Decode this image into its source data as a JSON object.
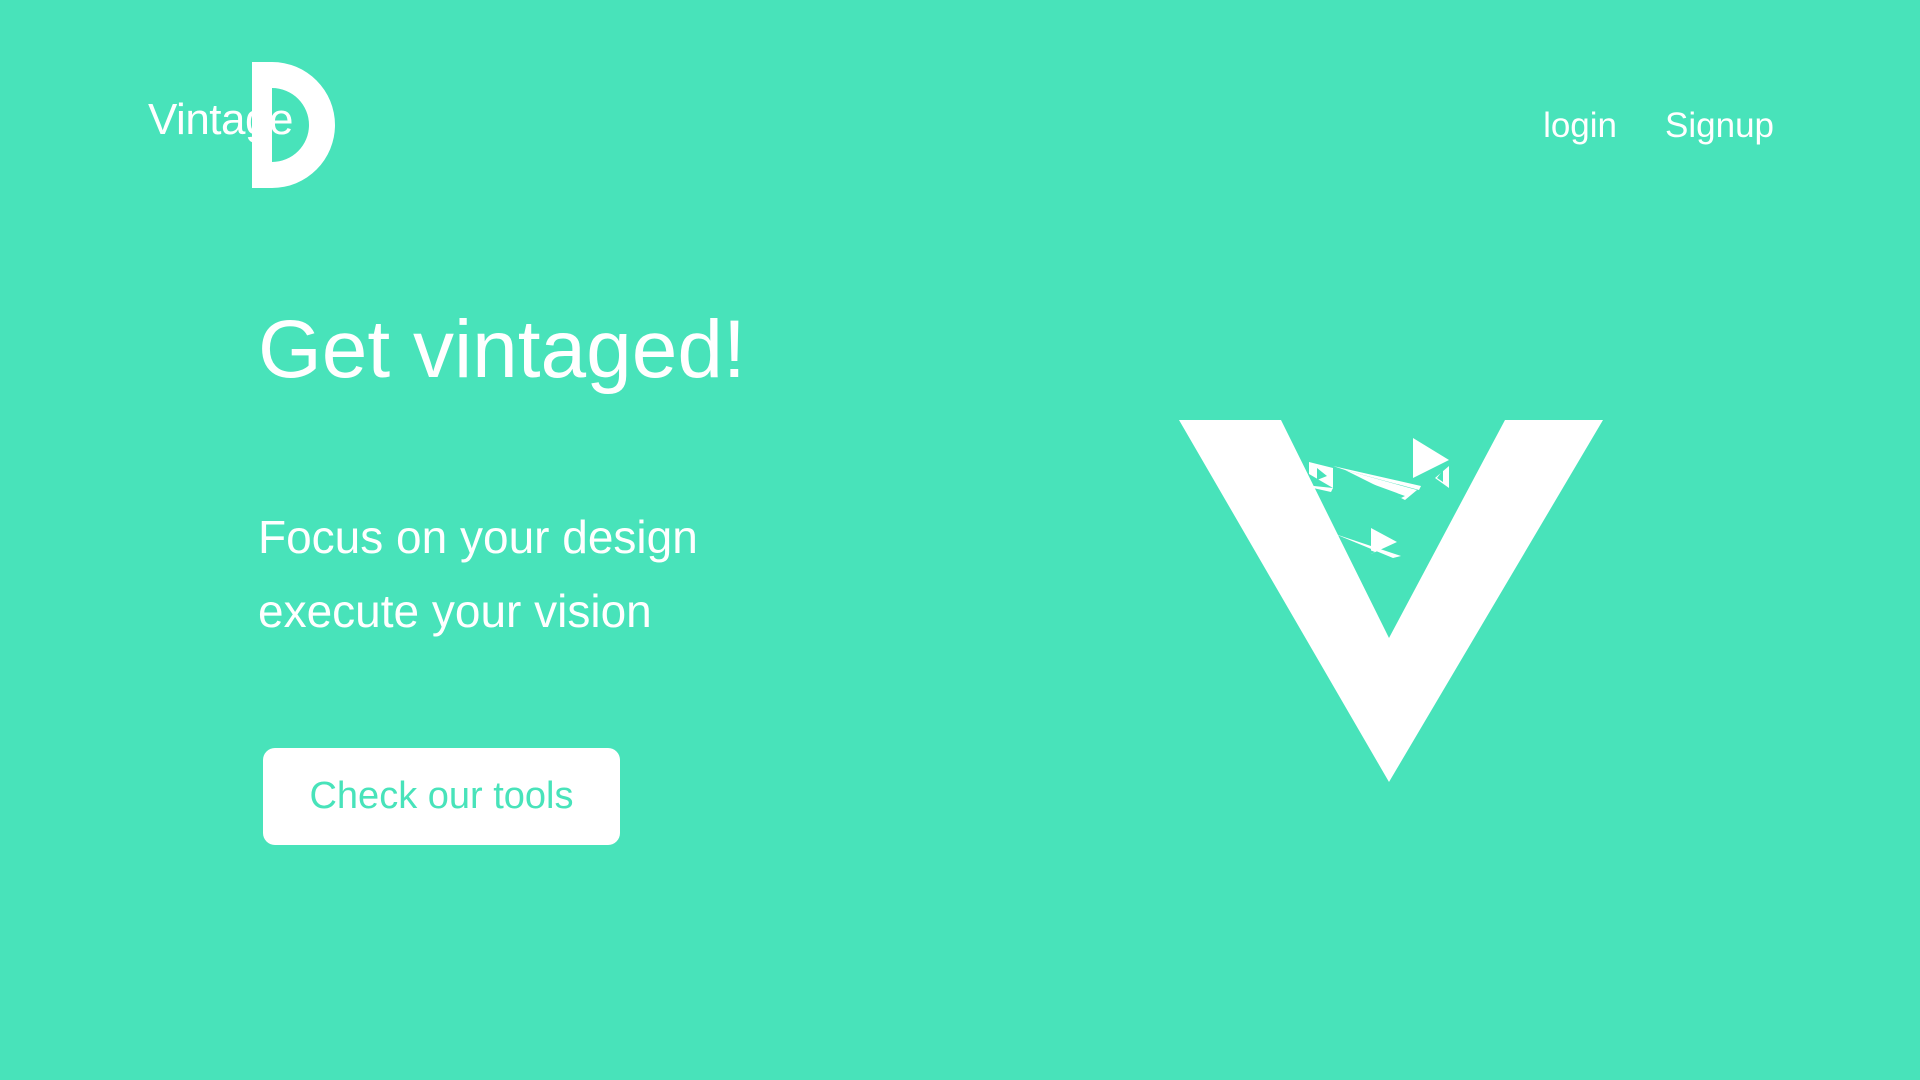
{
  "brand": {
    "name": "Vintage",
    "logo_icon": "d-half-circle-logo-icon"
  },
  "nav": {
    "login_label": "login",
    "signup_label": "Signup"
  },
  "hero": {
    "title": "Get vintaged!",
    "subtitle_line1": "Focus on your design",
    "subtitle_line2": "execute your vision",
    "cta_label": "Check our tools",
    "illustration_icon": "v-with-birds-icon"
  },
  "colors": {
    "background": "#48E3BA",
    "foreground": "#FFFFFF",
    "accent": "#48E3BA"
  }
}
